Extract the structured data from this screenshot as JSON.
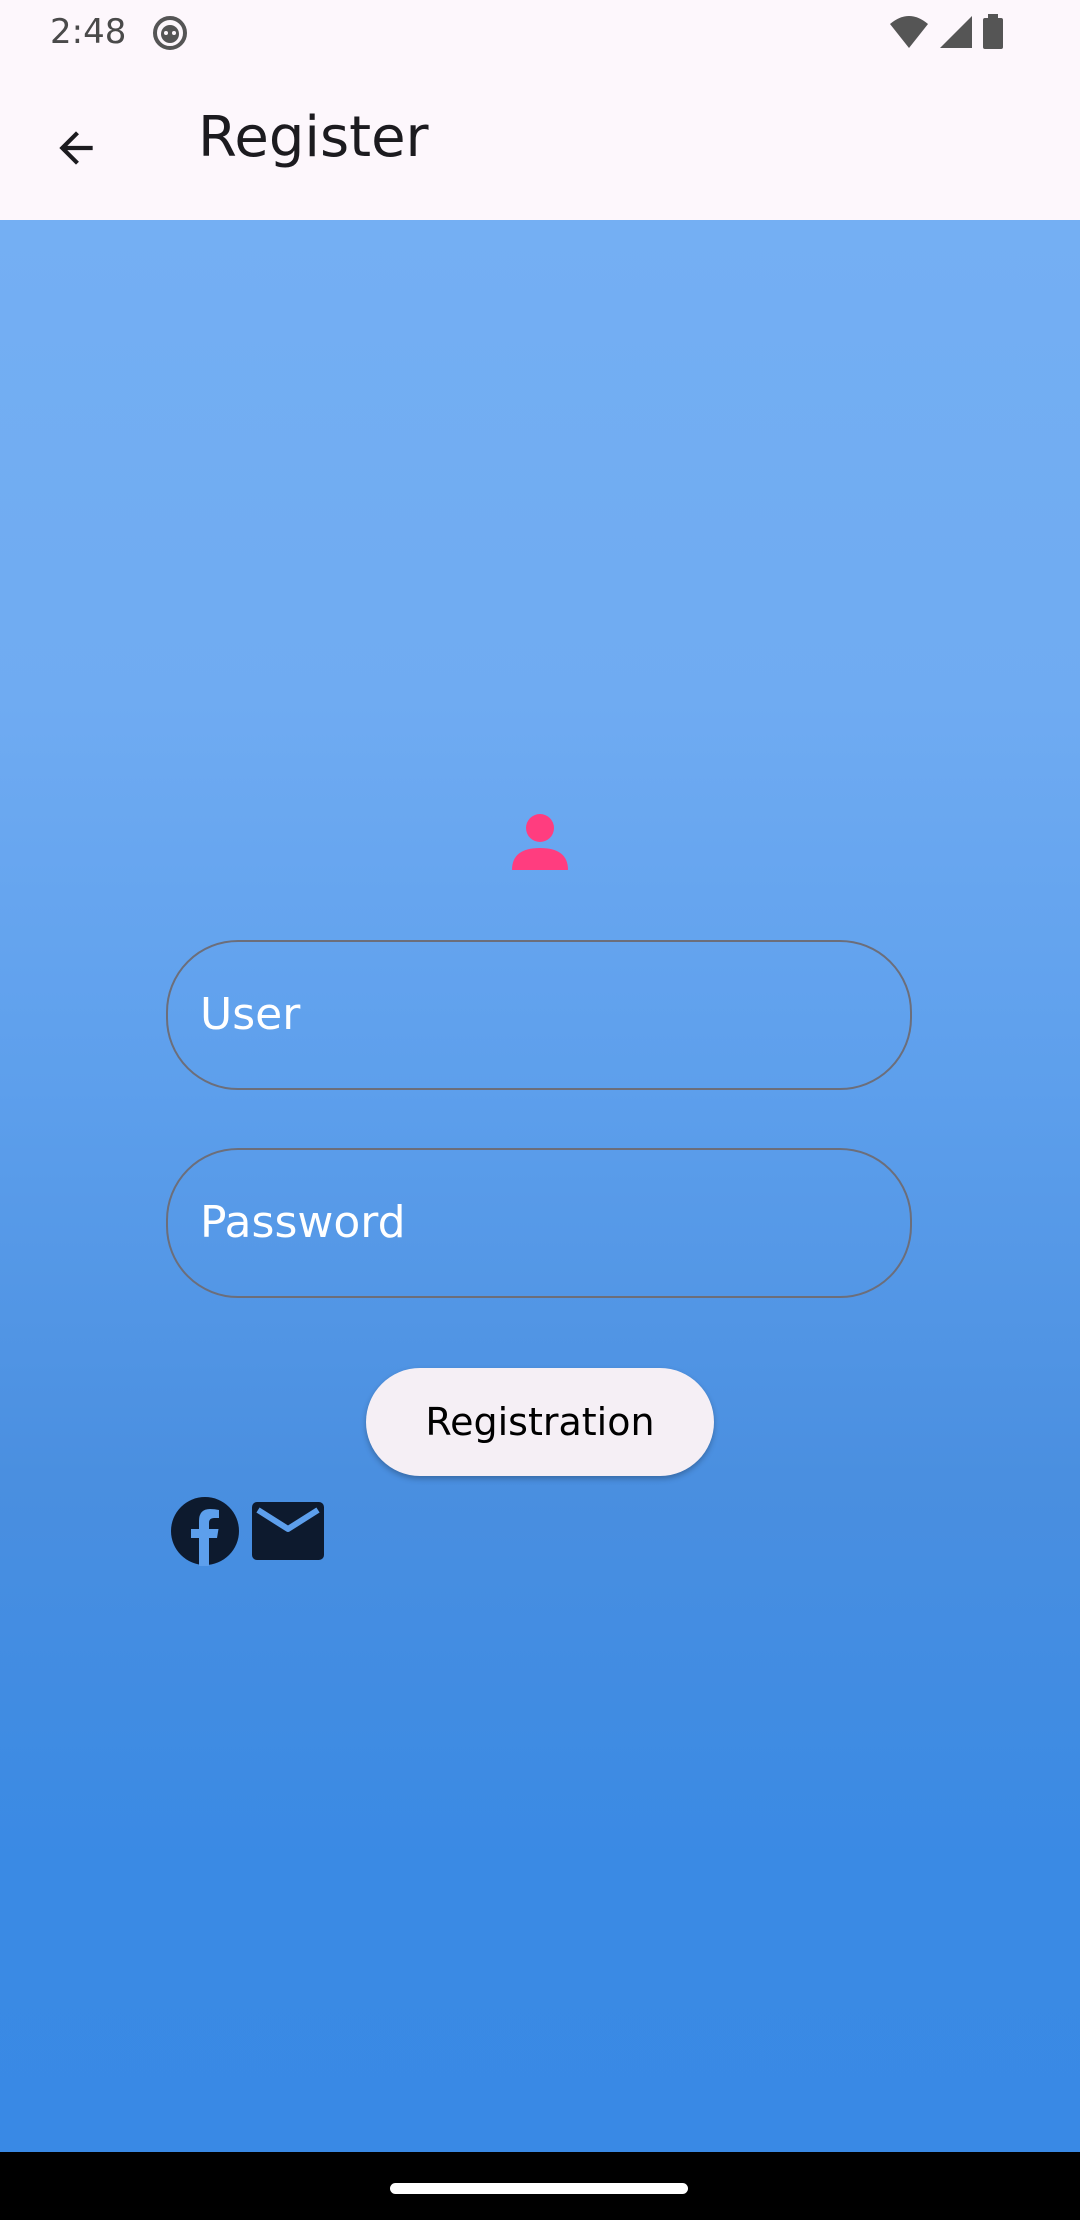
{
  "status_bar": {
    "time": "2:48"
  },
  "app_bar": {
    "title": "Register"
  },
  "form": {
    "user_placeholder": "User",
    "password_placeholder": "Password",
    "register_button": "Registration"
  },
  "colors": {
    "user_icon": "#ff3d7f",
    "gradient_top": "#74aff3",
    "gradient_bottom": "#3989e5",
    "button_bg": "#f5eff5",
    "social_icons": "#0d1a2e"
  },
  "icons": {
    "back": "arrow-back-icon",
    "user": "person-icon",
    "facebook": "facebook-icon",
    "mail": "mail-icon"
  }
}
